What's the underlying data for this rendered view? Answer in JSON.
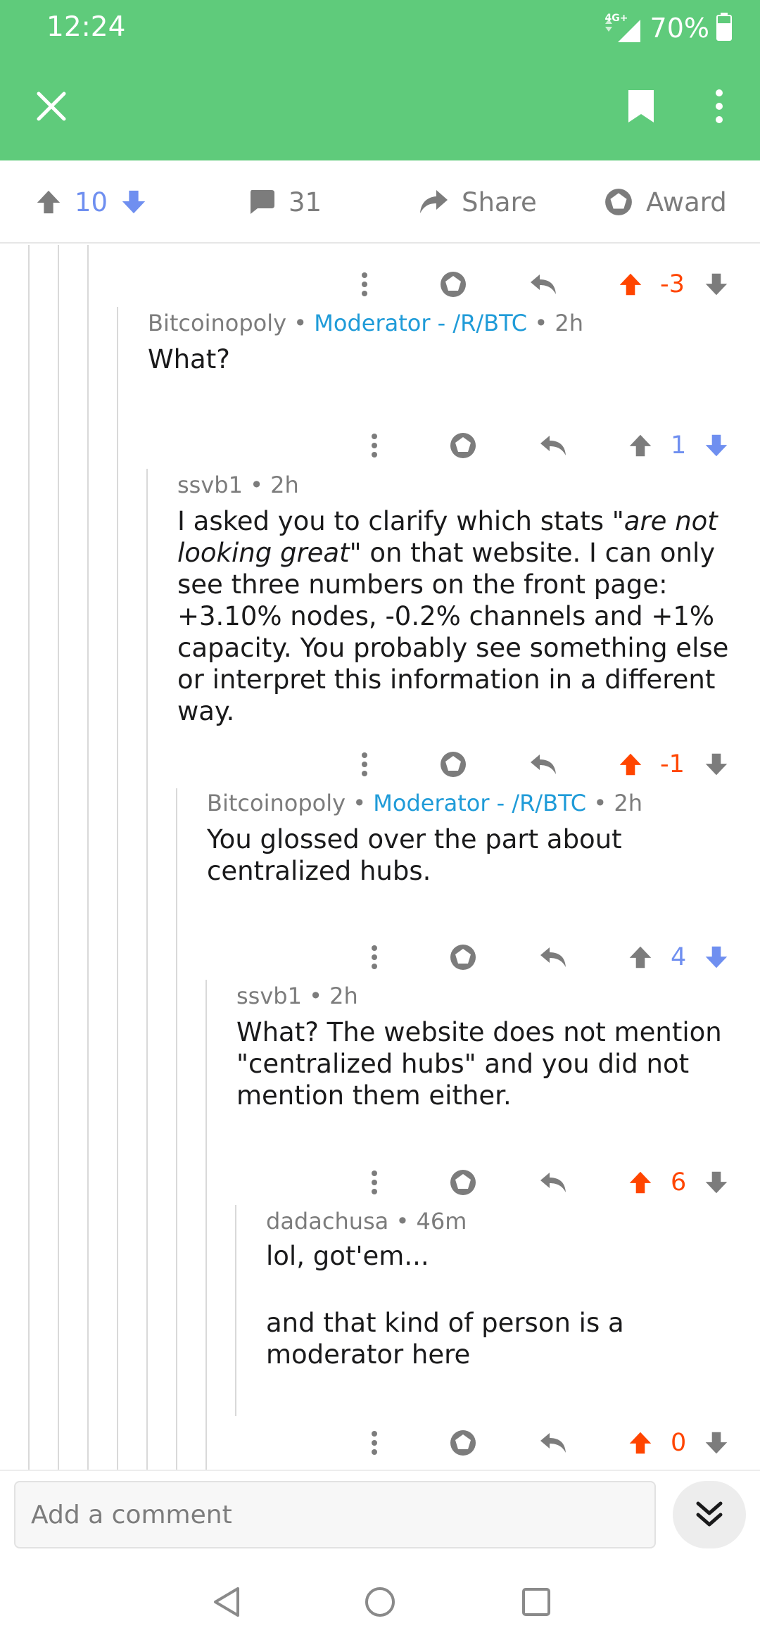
{
  "status_bar": {
    "time": "12:24",
    "network": "4G+",
    "battery": "70%"
  },
  "app_bar": {
    "close_icon": "close-icon",
    "bookmark_icon": "bookmark-icon",
    "more_icon": "more-vertical-icon"
  },
  "post_actions": {
    "vote_count": "10",
    "comment_count": "31",
    "share_label": "Share",
    "award_label": "Award"
  },
  "comments": [
    {
      "score": "-3",
      "vote_state": "upvoted"
    },
    {
      "author": "Bitcoinopoly",
      "flair": "Moderator - /R/BTC",
      "age": "2h",
      "text": "What?",
      "score": "1",
      "vote_state": "none"
    },
    {
      "author": "ssvb1",
      "age": "2h",
      "text_before": "I asked you to clarify which stats ",
      "text_italic": "\"are not looking great\"",
      "text_after": " on that website. I can only see three numbers on the front page: +3.10% nodes, -0.2% channels and +1% capacity. You probably see something else or interpret this information in a different way.",
      "score": "-1",
      "vote_state": "upvoted"
    },
    {
      "author": "Bitcoinopoly",
      "flair": "Moderator - /R/BTC",
      "age": "2h",
      "text": "You glossed over the part about centralized hubs.",
      "score": "4",
      "vote_state": "none"
    },
    {
      "author": "ssvb1",
      "age": "2h",
      "text": "What? The website does not mention \"centralized hubs\" and you did not mention them either.",
      "score": "6",
      "vote_state": "upvoted"
    },
    {
      "author": "dadachusa",
      "age": "46m",
      "text_line1": "lol, got'em...",
      "text_line2": "and that kind of person is a moderator here",
      "score": "0",
      "vote_state": "upvoted"
    }
  ],
  "composer": {
    "placeholder": "Add a comment"
  },
  "colors": {
    "header_green": "#5fcb7b",
    "upvote_orange": "#ff4500",
    "downvote_blue": "#6f8ff0",
    "moderator_blue": "#1f9bd8"
  }
}
